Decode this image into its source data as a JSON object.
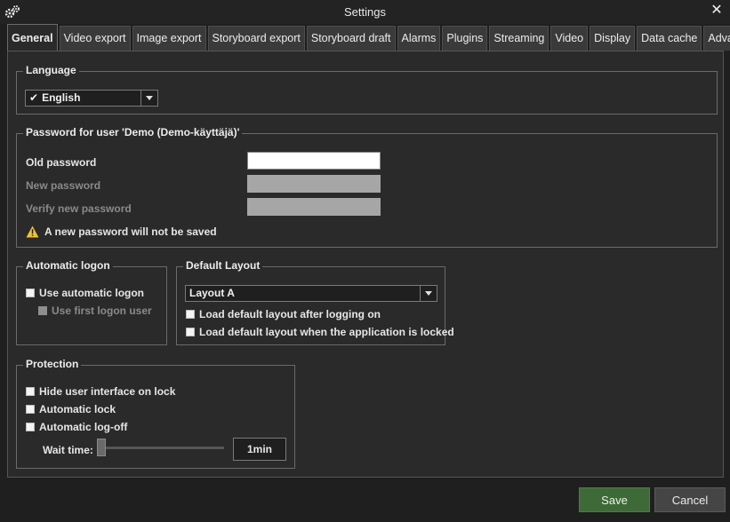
{
  "window": {
    "title": "Settings",
    "close_glyph": "✕"
  },
  "tabs": [
    {
      "label": "General",
      "active": true
    },
    {
      "label": "Video export"
    },
    {
      "label": "Image export"
    },
    {
      "label": "Storyboard export"
    },
    {
      "label": "Storyboard draft"
    },
    {
      "label": "Alarms"
    },
    {
      "label": "Plugins"
    },
    {
      "label": "Streaming"
    },
    {
      "label": "Video"
    },
    {
      "label": "Display"
    },
    {
      "label": "Data cache"
    },
    {
      "label": "Advanced"
    }
  ],
  "language": {
    "group_title": "Language",
    "check_glyph": "✔",
    "selected": "English"
  },
  "password": {
    "group_title": "Password for user 'Demo (Demo-käyttäjä)'",
    "old_label": "Old password",
    "old_value": "",
    "new_label": "New password",
    "verify_label": "Verify new password",
    "warning": "A new password will not be saved"
  },
  "logon": {
    "group_title": "Automatic logon",
    "use_auto": {
      "label": "Use automatic logon",
      "checked": false
    },
    "use_first": {
      "label": "Use first logon user",
      "checked": false,
      "disabled": true
    }
  },
  "layout": {
    "group_title": "Default Layout",
    "selected": "Layout A",
    "load_after_logon": {
      "label": "Load default layout after logging on",
      "checked": false
    },
    "load_when_locked": {
      "label": "Load default layout when the application is locked",
      "checked": false
    }
  },
  "protection": {
    "group_title": "Protection",
    "hide_ui": {
      "label": "Hide user interface on lock",
      "checked": false
    },
    "auto_lock": {
      "label": "Automatic lock",
      "checked": false
    },
    "auto_logoff": {
      "label": "Automatic log-off",
      "checked": false
    },
    "wait_label": "Wait time:",
    "wait_value": "1min",
    "wait_slider_fraction": 0
  },
  "footer": {
    "save_label": "Save",
    "cancel_label": "Cancel"
  },
  "colors": {
    "background": "#1f1f1f",
    "panel": "#2a2a2a",
    "save_button": "#3e6a37",
    "warning_icon": "#f2c230"
  },
  "icons": [
    "gears-icon",
    "close-icon",
    "check-icon",
    "warning-icon",
    "chevron-down-icon"
  ]
}
